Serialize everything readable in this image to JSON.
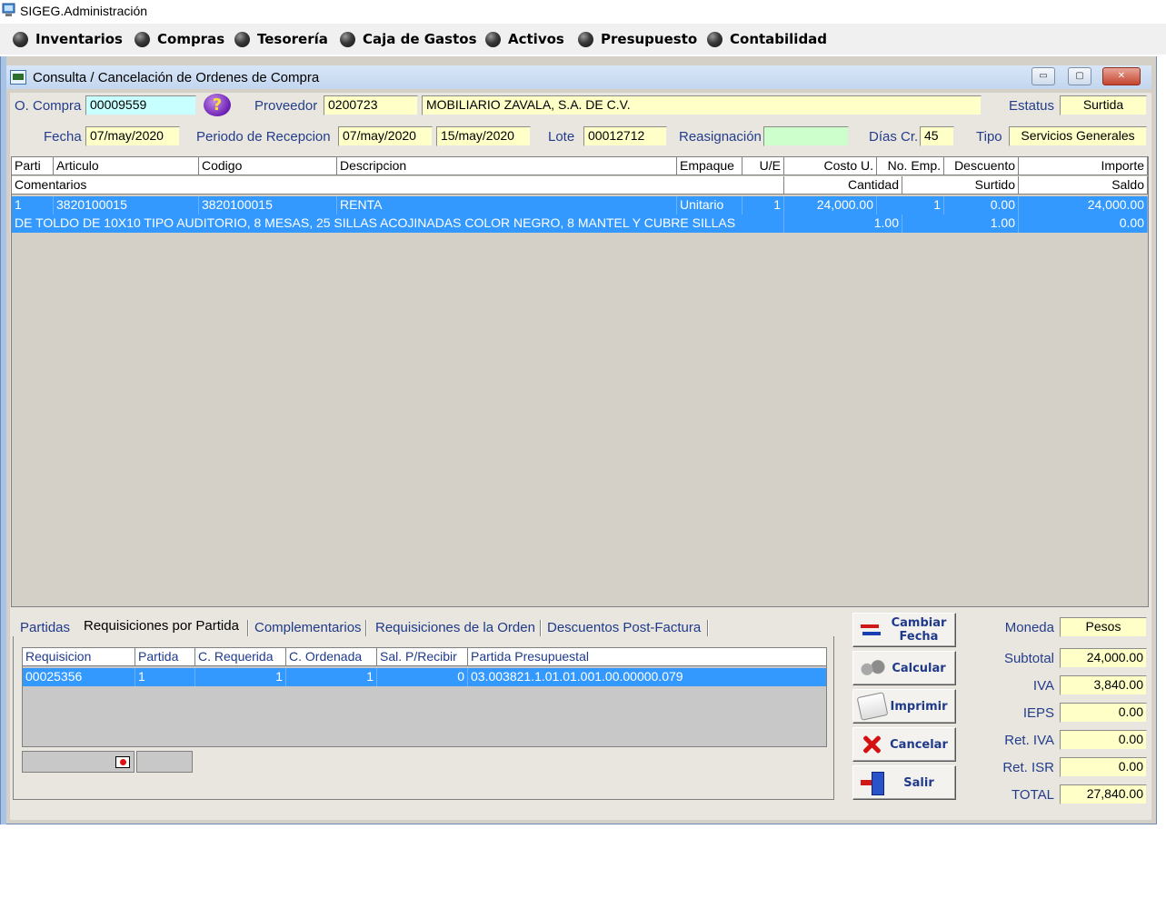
{
  "app": {
    "title": "SIGEG.Administración"
  },
  "menu": {
    "items": [
      {
        "label": "Inventarios"
      },
      {
        "label": "Compras"
      },
      {
        "label": "Tesorería"
      },
      {
        "label": "Caja de Gastos"
      },
      {
        "label": "Activos"
      },
      {
        "label": "Presupuesto"
      },
      {
        "label": "Contabilidad"
      }
    ]
  },
  "window": {
    "title": "Consulta / Cancelación de Ordenes de Compra",
    "minimize": "▭",
    "maximize": "▢",
    "close": "✕"
  },
  "form": {
    "ocompra_label": "O. Compra",
    "ocompra_value": "00009559",
    "help": "?",
    "proveedor_label": "Proveedor",
    "proveedor_code": "0200723",
    "proveedor_name": "MOBILIARIO ZAVALA, S.A. DE C.V.",
    "estatus_label": "Estatus",
    "estatus_value": "Surtida",
    "fecha_label": "Fecha",
    "fecha_value": "07/may/2020",
    "periodo_label": "Periodo de Recepcion",
    "periodo_desde": "07/may/2020",
    "periodo_hasta": "15/may/2020",
    "lote_label": "Lote",
    "lote_value": "00012712",
    "reasignacion_label": "Reasignación",
    "reasignacion_value": "",
    "diascr_label": "Días Cr.",
    "diascr_value": "45",
    "tipo_label": "Tipo",
    "tipo_value": "Servicios Generales"
  },
  "grid": {
    "headers1": [
      "Parti",
      "Articulo",
      "Codigo",
      "Descripcion",
      "Empaque",
      "U/E",
      "Costo U.",
      "No. Emp.",
      "Descuento",
      "Importe"
    ],
    "headers2": {
      "comentarios": "Comentarios",
      "cantidad": "Cantidad",
      "surtido": "Surtido",
      "saldo": "Saldo"
    },
    "row1": {
      "partida": "1",
      "articulo": "3820100015",
      "codigo": "3820100015",
      "descripcion": "RENTA",
      "empaque": "Unitario",
      "ue": "1",
      "costo": "24,000.00",
      "noemp": "1",
      "descuento": "0.00",
      "importe": "24,000.00"
    },
    "row2": {
      "comentario": "DE TOLDO DE 10X10 TIPO AUDITORIO, 8 MESAS, 25 SILLAS ACOJINADAS COLOR NEGRO, 8 MANTEL Y CUBRE SILLAS",
      "cantidad": "1.00",
      "surtido": "1.00",
      "saldo": "0.00"
    }
  },
  "tabs": [
    {
      "label": "Partidas"
    },
    {
      "label": "Requisiciones por Partida"
    },
    {
      "label": "Complementarios"
    },
    {
      "label": "Requisiciones de la Orden"
    },
    {
      "label": "Descuentos Post-Factura"
    }
  ],
  "subgrid": {
    "headers": [
      "Requisicion",
      "Partida",
      "C. Requerida",
      "C. Ordenada",
      "Sal. P/Recibir",
      "Partida Presupuestal"
    ],
    "row": {
      "requisicion": "00025356",
      "partida": "1",
      "c_requerida": "1",
      "c_ordenada": "1",
      "sal_recibir": "0",
      "partida_presupuestal": "03.003821.1.01.01.001.00.00000.079"
    }
  },
  "actions": {
    "cambiar_fecha_1": "Cambiar",
    "cambiar_fecha_2": "Fecha",
    "calcular": "Calcular",
    "imprimir": "Imprimir",
    "cancelar": "Cancelar",
    "salir": "Salir"
  },
  "totals": {
    "moneda_label": "Moneda",
    "moneda_value": "Pesos",
    "subtotal_label": "Subtotal",
    "subtotal_value": "24,000.00",
    "iva_label": "IVA",
    "iva_value": "3,840.00",
    "ieps_label": "IEPS",
    "ieps_value": "0.00",
    "retiva_label": "Ret. IVA",
    "retiva_value": "0.00",
    "retisr_label": "Ret. ISR",
    "retisr_value": "0.00",
    "total_label": "TOTAL",
    "total_value": "27,840.00"
  },
  "colors": {
    "selection": "#3399ff",
    "field_yellow": "#ffffc8",
    "field_cyan": "#c8ffff",
    "field_green": "#ccffcc",
    "label_blue": "#233d8c"
  }
}
